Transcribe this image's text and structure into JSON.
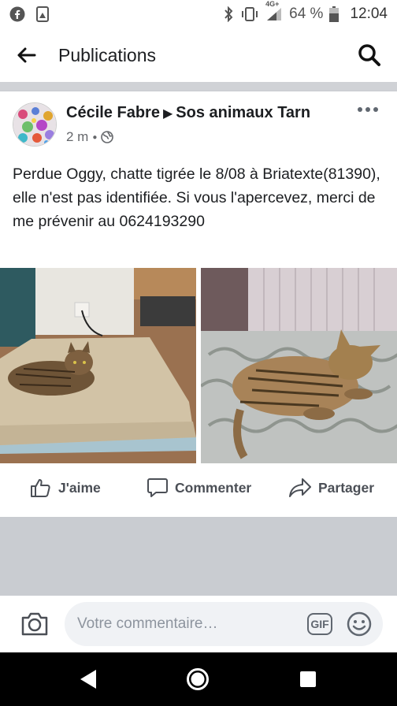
{
  "status_bar": {
    "network": "4G+",
    "battery": "64 %",
    "time": "12:04",
    "icons_left": [
      "facebook-icon",
      "image-icon"
    ],
    "icons_right": [
      "bluetooth-icon",
      "vibrate-icon",
      "signal-icon",
      "battery-icon"
    ]
  },
  "header": {
    "title": "Publications",
    "back_icon": "arrow-left-icon",
    "search_icon": "search-icon"
  },
  "post": {
    "author": "Cécile Fabre",
    "group": "Sos animaux Tarn",
    "time": "2 m",
    "privacy_icon": "globe-icon",
    "text": "Perdue Oggy, chatte tigrée le 8/08 à Briatexte(81390), elle n'est pas identifiée. Si vous l'apercevez, merci de me prévenir au 0624193290",
    "photos": [
      "tabby-cat-on-cushion",
      "tabby-cat-sleeping-on-bed"
    ]
  },
  "actions": {
    "like": "J'aime",
    "comment": "Commenter",
    "share": "Partager"
  },
  "comment_bar": {
    "placeholder": "Votre commentaire…",
    "gif_label": "GIF"
  }
}
